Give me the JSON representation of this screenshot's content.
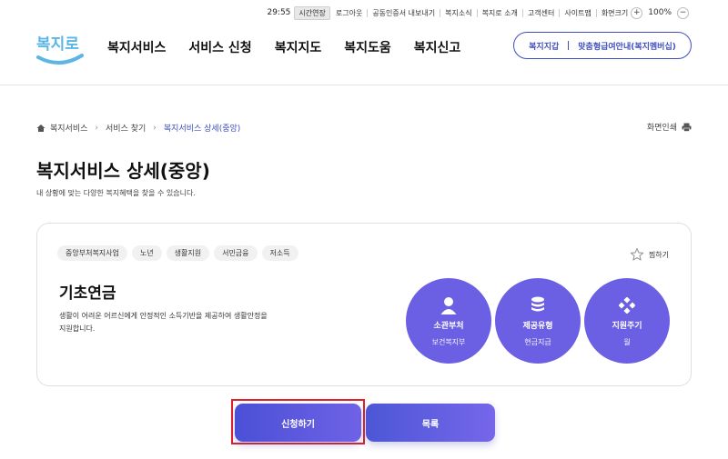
{
  "util": {
    "time": "29:55",
    "extend": "시간연장",
    "logout": "로그아웃",
    "cert_export": "공동인증서 내보내기",
    "news": "복지소식",
    "about": "복지로 소개",
    "support": "고객센터",
    "sitemap": "사이트맵",
    "screen_size": "화면크기",
    "plus": "+",
    "zoom": "100%",
    "minus": "−"
  },
  "header": {
    "logo_text": "복지로",
    "nav": [
      "복지서비스",
      "서비스 신청",
      "복지지도",
      "복지도움",
      "복지신고"
    ],
    "pill_left": "복지지갑",
    "pill_right": "맞춤형급여안내(복지멤버십)"
  },
  "breadcrumb": [
    "복지서비스",
    "서비스 찾기",
    "복지서비스 상세(중앙)"
  ],
  "print_label": "화면인쇄",
  "page": {
    "title": "복지서비스 상세(중앙)",
    "subtitle": "내 상황에 맞는 다양한 복지혜택을 찾을 수 있습니다."
  },
  "card": {
    "tags": [
      "중앙부처복지사업",
      "노년",
      "생활지원",
      "서민금융",
      "저소득"
    ],
    "fav_label": "찜하기",
    "name": "기초연금",
    "desc": "생활이 어려운 어르신에게 안정적인 소득기반을 제공하여 생활안정을 지원합니다.",
    "info": [
      {
        "title": "소관부처",
        "value": "보건복지부",
        "icon": "user-icon"
      },
      {
        "title": "제공유형",
        "value": "현금지급",
        "icon": "coins-icon"
      },
      {
        "title": "지원주기",
        "value": "월",
        "icon": "diamond-grid-icon"
      }
    ]
  },
  "buttons": {
    "apply": "신청하기",
    "list": "목록"
  },
  "colors": {
    "accent": "#3f4fc0",
    "bubble": "#6b5fe3",
    "highlight": "#e0202a"
  }
}
